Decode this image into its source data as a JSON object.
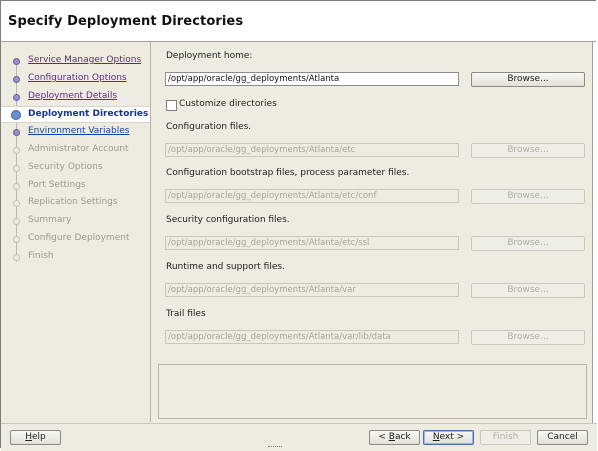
{
  "header": {
    "title": "Specify Deployment Directories"
  },
  "nav": {
    "steps": [
      {
        "label": "Service Manager Options",
        "state": "done"
      },
      {
        "label": "Configuration Options",
        "state": "done"
      },
      {
        "label": "Deployment Details",
        "state": "done"
      },
      {
        "label": "Deployment Directories",
        "state": "current"
      },
      {
        "label": "Environment Variables",
        "state": "link"
      },
      {
        "label": "Administrator Account",
        "state": "disabled"
      },
      {
        "label": "Security Options",
        "state": "disabled"
      },
      {
        "label": "Port Settings",
        "state": "disabled"
      },
      {
        "label": "Replication Settings",
        "state": "disabled"
      },
      {
        "label": "Summary",
        "state": "disabled"
      },
      {
        "label": "Configure Deployment",
        "state": "disabled"
      },
      {
        "label": "Finish",
        "state": "disabled"
      }
    ]
  },
  "form": {
    "deployment_home": {
      "label": "Deployment home:",
      "value": "/opt/app/oracle/gg_deployments/Atlanta",
      "browse": "Browse..."
    },
    "customize": {
      "label": "Customize directories",
      "checked": false
    },
    "config_files": {
      "label": "Configuration files.",
      "value": "/opt/app/oracle/gg_deployments/Atlanta/etc",
      "browse": "Browse..."
    },
    "bootstrap_files": {
      "label": "Configuration bootstrap files, process parameter files.",
      "value": "/opt/app/oracle/gg_deployments/Atlanta/etc/conf",
      "browse": "Browse..."
    },
    "security_files": {
      "label": "Security configuration files.",
      "value": "/opt/app/oracle/gg_deployments/Atlanta/etc/ssl",
      "browse": "Browse..."
    },
    "runtime_files": {
      "label": "Runtime and support files.",
      "value": "/opt/app/oracle/gg_deployments/Atlanta/var",
      "browse": "Browse..."
    },
    "trail_files": {
      "label": "Trail files",
      "value": "/opt/app/oracle/gg_deployments/Atlanta/var/lib/data",
      "browse": "Browse..."
    }
  },
  "footer": {
    "help": {
      "mnemonic": "H",
      "rest": "elp"
    },
    "back": {
      "prefix": "< ",
      "mnemonic": "B",
      "rest": "ack"
    },
    "next": {
      "mnemonic": "N",
      "rest": "ext >"
    },
    "finish": "Finish",
    "cancel": "Cancel"
  }
}
